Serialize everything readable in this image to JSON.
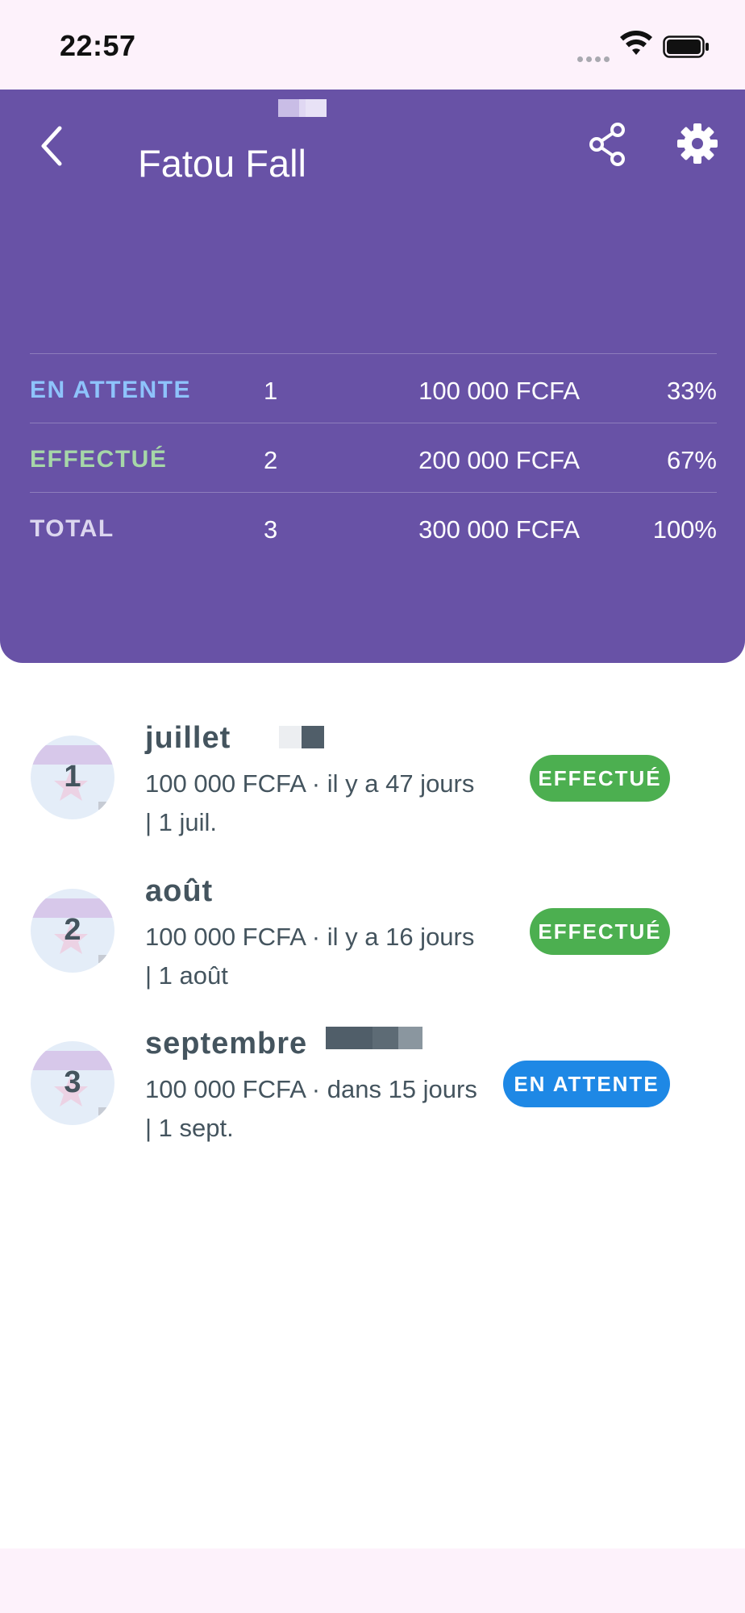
{
  "status_bar": {
    "time": "22:57"
  },
  "header": {
    "title": "Fatou Fall",
    "stats": [
      {
        "label": "EN ATTENTE",
        "count": "1",
        "amount": "100 000 FCFA",
        "percent": "33%",
        "color": "#8ec3fb"
      },
      {
        "label": "EFFECTUÉ",
        "count": "2",
        "amount": "200 000 FCFA",
        "percent": "67%",
        "color": "#a6d7a8"
      },
      {
        "label": "TOTAL",
        "count": "3",
        "amount": "300 000 FCFA",
        "percent": "100%",
        "color": "#dcd6ef"
      }
    ]
  },
  "items": [
    {
      "number": "1",
      "title": "juillet",
      "subtitle": "100 000 FCFA · il y a 47 jours | 1 juil.",
      "status": "EFFECTUÉ",
      "status_color": "#4caf50"
    },
    {
      "number": "2",
      "title": "août",
      "subtitle": "100 000 FCFA · il y a 16 jours | 1 août",
      "status": "EFFECTUÉ",
      "status_color": "#4caf50"
    },
    {
      "number": "3",
      "title": "septembre",
      "subtitle": "100 000 FCFA · dans 15 jours | 1 sept.",
      "status": "EN ATTENTE",
      "status_color": "#1e88e5"
    }
  ],
  "icons": {
    "back": "chevron-left-icon",
    "share": "share-icon",
    "settings": "gear-icon",
    "item_avatar": "star-icon"
  },
  "colors": {
    "header_bg": "#6852a6",
    "text_dark": "#44545e",
    "status_bar_bg": "#fdf2fb"
  }
}
